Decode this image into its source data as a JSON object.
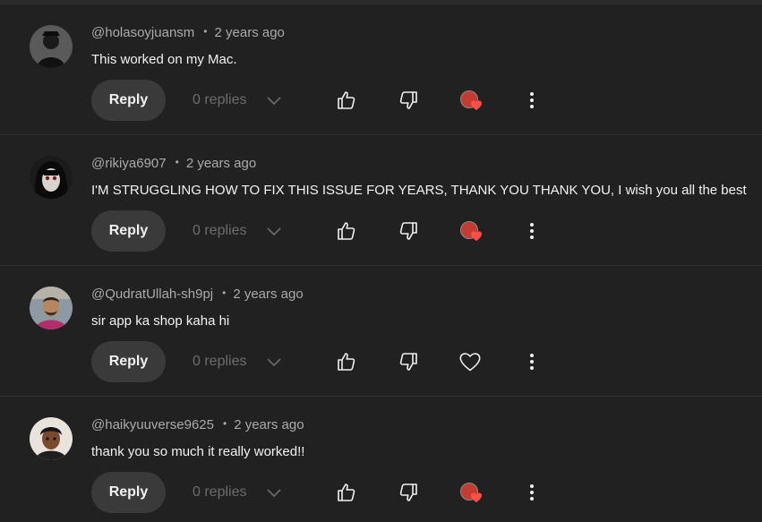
{
  "comments": [
    {
      "handle": "@holasoyjuansm",
      "separator": "•",
      "time": "2 years ago",
      "text": "This worked on my Mac.",
      "reply_label": "Reply",
      "replies_label": "0 replies",
      "creator_hearted": true,
      "avatar_icon": "avatar-dark-figure"
    },
    {
      "handle": "@rikiya6907",
      "separator": "•",
      "time": "2 years ago",
      "text": "I'M STRUGGLING HOW TO FIX THIS ISSUE FOR YEARS, THANK YOU THANK YOU, I wish you all the best",
      "reply_label": "Reply",
      "replies_label": "0 replies",
      "creator_hearted": true,
      "avatar_icon": "avatar-anime-girl"
    },
    {
      "handle": "@QudratUllah-sh9pj",
      "separator": "•",
      "time": "2 years ago",
      "text": "sir app ka shop kaha hi",
      "reply_label": "Reply",
      "replies_label": "0 replies",
      "creator_hearted": false,
      "avatar_icon": "avatar-photo-man"
    },
    {
      "handle": "@haikyuuverse9625",
      "separator": "•",
      "time": "2 years ago",
      "text": "thank you so much it really worked!!",
      "reply_label": "Reply",
      "replies_label": "0 replies",
      "creator_hearted": true,
      "avatar_icon": "avatar-anime-boy"
    }
  ],
  "colors": {
    "background": "#212121",
    "text_primary": "#f1f1f1",
    "text_secondary": "#aaaaaa",
    "button_bg": "#3a3a3a",
    "heart_red": "#ff4e45"
  },
  "icons": {
    "like": "thumbs-up-icon",
    "dislike": "thumbs-down-icon",
    "chevron": "chevron-down-icon",
    "more": "more-vertical-icon",
    "heart": "heart-icon"
  }
}
